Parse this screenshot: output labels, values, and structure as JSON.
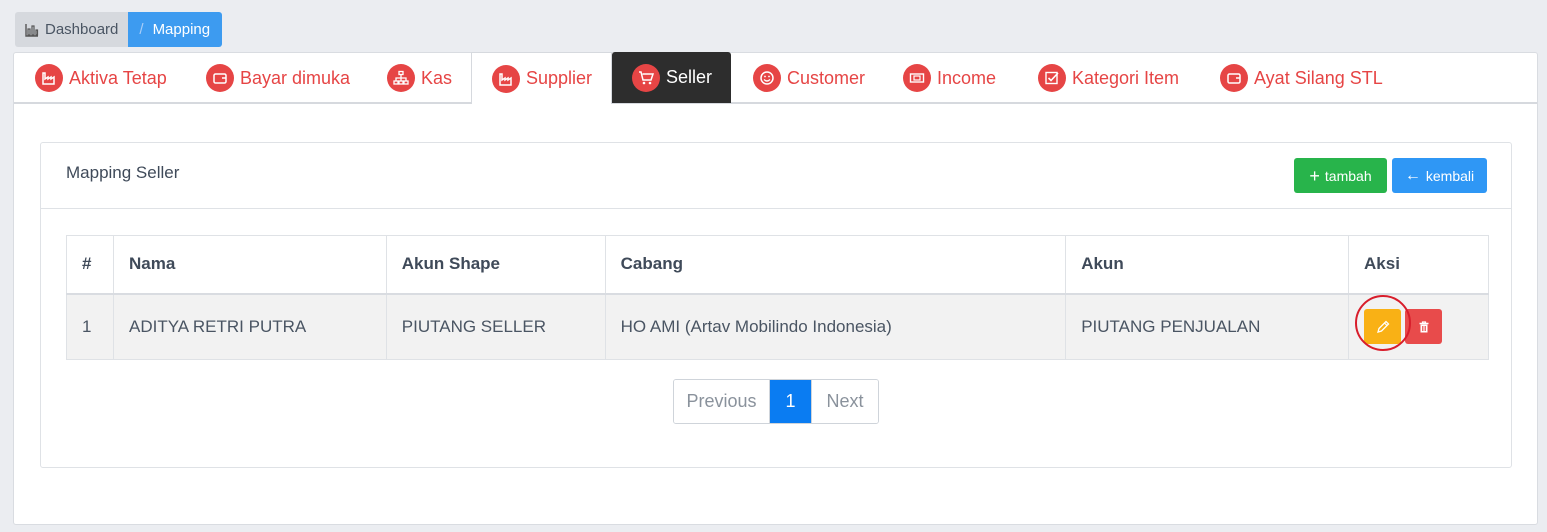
{
  "breadcrumb": {
    "dashboard": "Dashboard",
    "separator": "/",
    "current": "Mapping"
  },
  "tabs": [
    {
      "label": "Aktiva Tetap",
      "icon": "factory-icon"
    },
    {
      "label": "Bayar dimuka",
      "icon": "wallet-icon"
    },
    {
      "label": "Kas",
      "icon": "sitemap-icon"
    },
    {
      "label": "Supplier",
      "icon": "factory-icon"
    },
    {
      "label": "Seller",
      "icon": "cart-icon"
    },
    {
      "label": "Customer",
      "icon": "smile-icon"
    },
    {
      "label": "Income",
      "icon": "money-icon"
    },
    {
      "label": "Kategori Item",
      "icon": "checkbox-icon"
    },
    {
      "label": "Ayat Silang STL",
      "icon": "wallet-icon"
    }
  ],
  "active_tab": "Seller",
  "card": {
    "title": "Mapping Seller",
    "add_label": "tambah",
    "back_label": "kembali"
  },
  "table": {
    "headers": [
      "#",
      "Nama",
      "Akun Shape",
      "Cabang",
      "Akun",
      "Aksi"
    ],
    "rows": [
      [
        "1",
        "ADITYA RETRI PUTRA",
        "PIUTANG SELLER",
        "HO AMI (Artav Mobilindo Indonesia)",
        "PIUTANG PENJUALAN"
      ]
    ]
  },
  "pagination": {
    "previous": "Previous",
    "current": "1",
    "next": "Next"
  },
  "colors": {
    "accent": "#e64545",
    "primary": "#0a7cf2",
    "success": "#28b44b",
    "warning": "#f9b115",
    "danger": "#e84b4b"
  }
}
